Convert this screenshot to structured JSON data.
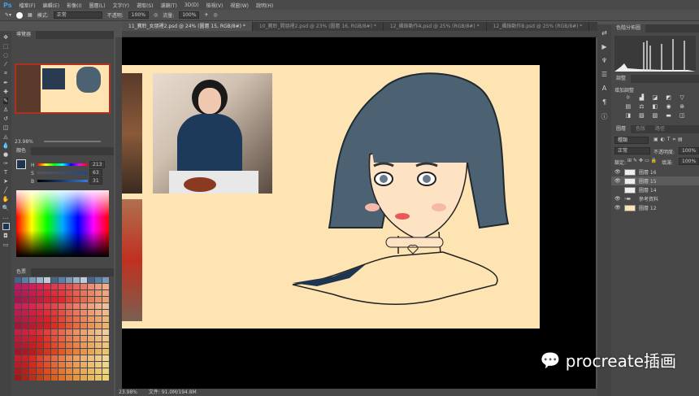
{
  "app": {
    "logo": "Ps"
  },
  "menu": [
    "檔案(F)",
    "編輯(E)",
    "影像(I)",
    "圖層(L)",
    "文字(Y)",
    "選取(S)",
    "濾鏡(T)",
    "3D(D)",
    "檢視(V)",
    "視窗(W)",
    "說明(H)"
  ],
  "options": {
    "mode_label": "模式:",
    "mode_value": "正常",
    "opacity_label": "不透明:",
    "opacity_value": "100%",
    "flow_label": "流量:",
    "flow_value": "100%"
  },
  "tabs": [
    {
      "label": "11_寶聆_女朋裡2.psd @ 24% (圖層 15, RGB/8#) *"
    },
    {
      "label": "10_寶聆_開朋裡2.psd @ 23% (圖層 16, RGB/8#) *"
    },
    {
      "label": "12_攝錄動作A.psd @ 25% (RGB/8#) *"
    },
    {
      "label": "12_攝錄動作B.psd @ 25% (RGB/8#) *"
    }
  ],
  "navigator": {
    "title": "導覽器",
    "zoom": "23.98%"
  },
  "color_panel": {
    "title": "顏色",
    "h_label": "H",
    "h": "213",
    "s_label": "S",
    "s": "63",
    "b_label": "B",
    "b": "31",
    "unit": "%",
    "deg": "°",
    "foreground": "#1e3550"
  },
  "swatches": {
    "title": "色票"
  },
  "histogram": {
    "title": "色階分佈圖"
  },
  "adjustments": {
    "title": "調整",
    "subtitle": "增加調整"
  },
  "layers_panel": {
    "tabs": [
      "圖層",
      "色版",
      "路徑"
    ],
    "kind": "種類",
    "blend": "正常",
    "opacity_label": "不透明度:",
    "opacity": "100%",
    "lock_label": "鎖定:",
    "fill_label": "填滿:",
    "fill": "100%",
    "layers": [
      {
        "name": "圖層 16"
      },
      {
        "name": "圖層 15"
      },
      {
        "name": "圖層 14"
      },
      {
        "name": "參考資料"
      },
      {
        "name": "圖層 12"
      }
    ]
  },
  "status": {
    "zoom": "23.98%",
    "doc": "文件: 91.0M/194.8M"
  },
  "watermark": "procreate插画"
}
